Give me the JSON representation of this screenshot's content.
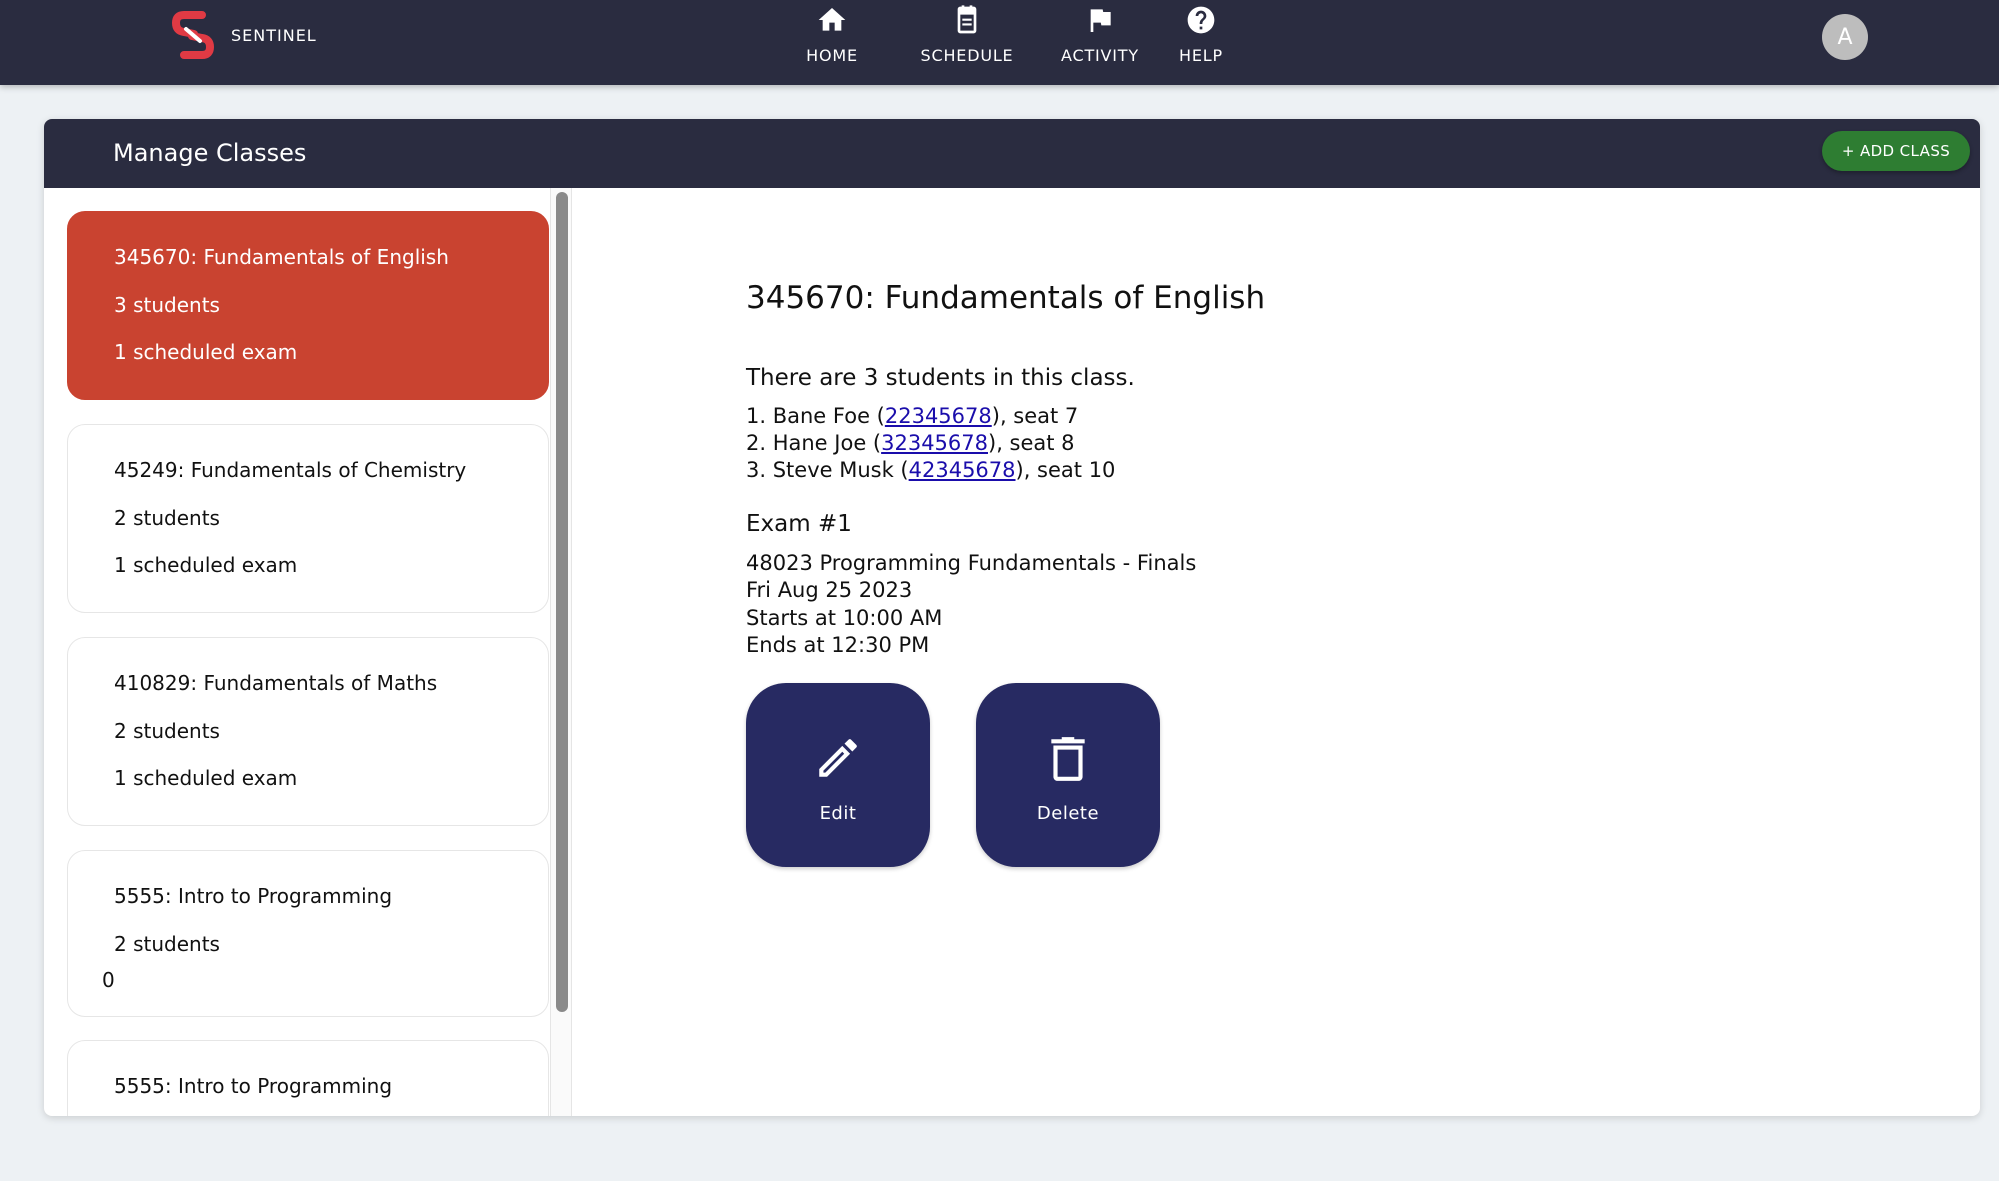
{
  "brand": {
    "name": "SENTINEL"
  },
  "nav": [
    {
      "label": "HOME",
      "icon": "home-icon"
    },
    {
      "label": "SCHEDULE",
      "icon": "calendar-icon"
    },
    {
      "label": "ACTIVITY",
      "icon": "flag-icon"
    },
    {
      "label": "HELP",
      "icon": "help-icon"
    }
  ],
  "user": {
    "avatar_initial": "A"
  },
  "page": {
    "title": "Manage Classes",
    "add_button": "+ ADD CLASS"
  },
  "classes": [
    {
      "title": "345670: Fundamentals of English",
      "students": "3 students",
      "exams": "1 scheduled exam",
      "active": true
    },
    {
      "title": "45249: Fundamentals of Chemistry",
      "students": "2 students",
      "exams": "1 scheduled exam"
    },
    {
      "title": "410829: Fundamentals of Maths",
      "students": "2 students",
      "exams": "1 scheduled exam"
    },
    {
      "title": "5555: Intro to Programming",
      "students": "2 students",
      "exams": "0"
    },
    {
      "title": "5555: Intro to Programming"
    }
  ],
  "detail": {
    "title": "345670: Fundamentals of English",
    "student_count_text": "There are 3 students in this class.",
    "students": [
      {
        "prefix": "1. Bane Foe (",
        "id": "22345678",
        "suffix": "), seat 7"
      },
      {
        "prefix": "2. Hane Joe (",
        "id": "32345678",
        "suffix": "), seat 8"
      },
      {
        "prefix": "3. Steve Musk (",
        "id": "42345678",
        "suffix": "), seat 10"
      }
    ],
    "exam_heading": "Exam #1",
    "exam_lines": [
      "48023 Programming Fundamentals - Finals",
      "Fri Aug 25 2023",
      "Starts at 10:00 AM",
      "Ends at 12:30 PM"
    ],
    "edit_label": "Edit",
    "delete_label": "Delete"
  },
  "colors": {
    "topbar": "#2a2c40",
    "active_item": "#c94330",
    "add_button": "#2e7d32",
    "action_button": "#272a62",
    "link": "#1a0dab"
  }
}
